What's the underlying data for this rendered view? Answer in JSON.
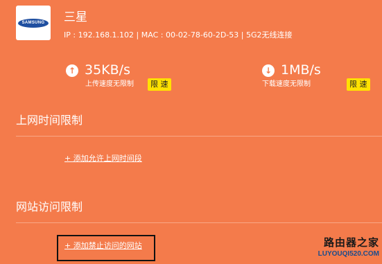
{
  "device": {
    "logo_text": "SAMSUNG",
    "name": "三星",
    "info": "IP : 192.168.1.102 | MAC : 00-02-78-60-2D-53 | 5G2无线连接"
  },
  "upload": {
    "icon": "arrow-up-circle-icon",
    "value": "35KB/s",
    "label": "上传速度无限制",
    "button": "限 速"
  },
  "download": {
    "icon": "arrow-down-circle-icon",
    "value": "1MB/s",
    "label": "下载速度无限制",
    "button": "限 速"
  },
  "time_limit": {
    "title": "上网时间限制",
    "add_link": "+ 添加允许上网时间段"
  },
  "site_limit": {
    "title": "网站访问限制",
    "add_link": "+ 添加禁止访问的网站"
  },
  "watermark": {
    "main": "路由器之家",
    "sub": "LUYOUQI520.COM"
  },
  "colors": {
    "background": "#f47b4b",
    "button": "#ffe100"
  }
}
